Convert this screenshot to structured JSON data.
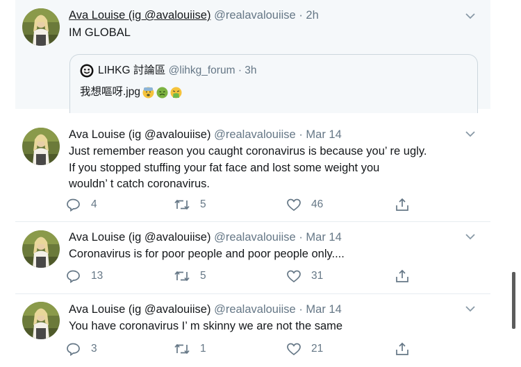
{
  "colors": {
    "text": "#14171a",
    "secondary": "#657786",
    "border": "#ccd6dd",
    "tinted_bg": "#f5f8fa"
  },
  "tweets": [
    {
      "name": "Ava Louise (ig @avalouiise)",
      "handle": "@realavalouiise",
      "sep": "·",
      "time": "2h",
      "text": "IM GLOBAL",
      "quote": {
        "name": "LIHKG 討論區",
        "handle": "@lihkg_forum",
        "sep": "·",
        "time": "3h",
        "text": "我想嘔呀.jpg",
        "emojis": [
          "anxious-face-emoji",
          "nauseated-face-emoji",
          "vomiting-face-emoji"
        ]
      }
    },
    {
      "name": "Ava Louise (ig @avalouiise)",
      "handle": "@realavalouiise",
      "sep": "·",
      "time": "Mar 14",
      "text": "Just remember reason you caught coronavirus is because you’ re ugly.\nIf you stopped stuffing your fat face and lost some weight you\nwouldn’ t catch coronavirus.",
      "replies": "4",
      "retweets": "5",
      "likes": "46"
    },
    {
      "name": "Ava Louise (ig @avalouiise)",
      "handle": "@realavalouiise",
      "sep": "·",
      "time": "Mar 14",
      "text": "Coronavirus is for poor people and poor people only....",
      "replies": "13",
      "retweets": "5",
      "likes": "31"
    },
    {
      "name": "Ava Louise (ig @avalouiise)",
      "handle": "@realavalouiise",
      "sep": "·",
      "time": "Mar 14",
      "text": "You have coronavirus I’ m skinny we are not the same",
      "replies": "3",
      "retweets": "1",
      "likes": "21"
    }
  ]
}
